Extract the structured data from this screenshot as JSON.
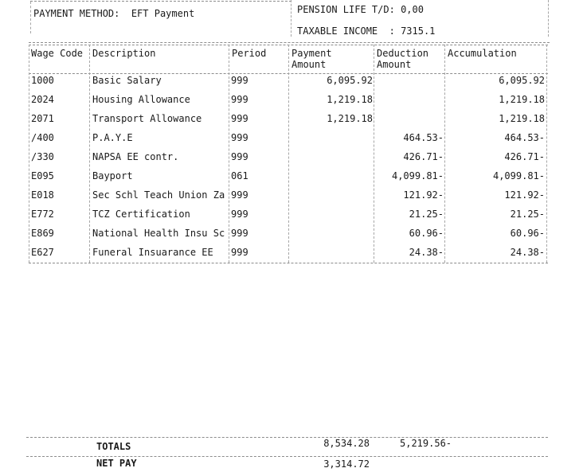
{
  "header": {
    "payment_method_label": "PAYMENT METHOD:",
    "payment_method_value": "EFT Payment",
    "pension_label": "PENSION LIFE T/D:",
    "pension_value": "0,00",
    "taxable_label": "TAXABLE INCOME  :",
    "taxable_value": "7315.1"
  },
  "table": {
    "columns": {
      "wage_code": "Wage Code",
      "description": "Description",
      "period": "Period",
      "payment_1": "Payment",
      "payment_2": "Amount",
      "deduction_1": "Deduction",
      "deduction_2": "Amount",
      "accumulation": "Accumulation"
    },
    "rows": [
      {
        "code": "1000",
        "description": "Basic Salary",
        "period": "999",
        "payment": "6,095.92",
        "deduction": "",
        "accumulation": "6,095.92"
      },
      {
        "code": "2024",
        "description": "Housing Allowance",
        "period": "999",
        "payment": "1,219.18",
        "deduction": "",
        "accumulation": "1,219.18"
      },
      {
        "code": "2071",
        "description": "Transport Allowance",
        "period": "999",
        "payment": "1,219.18",
        "deduction": "",
        "accumulation": "1,219.18"
      },
      {
        "code": "/400",
        "description": "P.A.Y.E",
        "period": "999",
        "payment": "",
        "deduction": "464.53-",
        "accumulation": "464.53-"
      },
      {
        "code": "/330",
        "description": "NAPSA EE contr.",
        "period": "999",
        "payment": "",
        "deduction": "426.71-",
        "accumulation": "426.71-"
      },
      {
        "code": "E095",
        "description": "Bayport",
        "period": "061",
        "payment": "",
        "deduction": "4,099.81-",
        "accumulation": "4,099.81-"
      },
      {
        "code": "E018",
        "description": "Sec Schl Teach Union Za",
        "period": "999",
        "payment": "",
        "deduction": "121.92-",
        "accumulation": "121.92-"
      },
      {
        "code": "E772",
        "description": "TCZ Certification",
        "period": "999",
        "payment": "",
        "deduction": "21.25-",
        "accumulation": "21.25-"
      },
      {
        "code": "E869",
        "description": "National Health Insu Sc",
        "period": "999",
        "payment": "",
        "deduction": "60.96-",
        "accumulation": "60.96-"
      },
      {
        "code": "E627",
        "description": "Funeral Insuarance EE",
        "period": "999",
        "payment": "",
        "deduction": "24.38-",
        "accumulation": "24.38-"
      }
    ]
  },
  "totals": {
    "label": "TOTALS",
    "payment_total": "8,534.28",
    "deduction_total": "5,219.56-",
    "net_pay_label": "NET PAY",
    "net_pay_value": "3,314.72"
  }
}
